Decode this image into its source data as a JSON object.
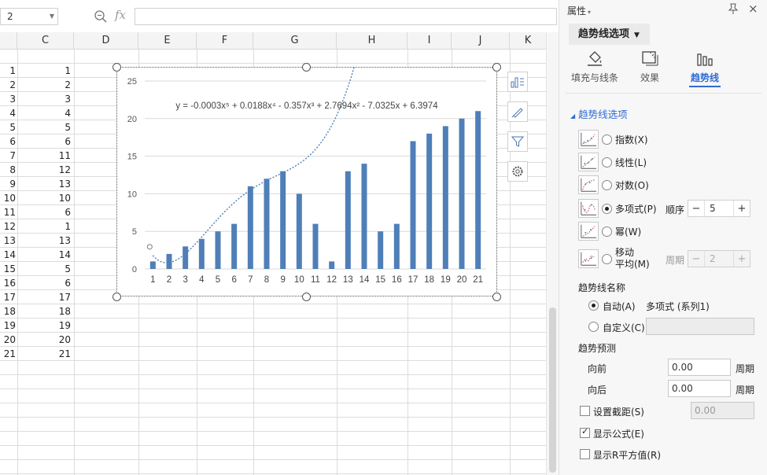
{
  "formula_bar": {
    "name_box": "2",
    "fx_label": "fx",
    "formula": ""
  },
  "columns": [
    "C",
    "D",
    "E",
    "F",
    "G",
    "H",
    "I",
    "J",
    "K"
  ],
  "rows": [
    {
      "n": "1",
      "c": "1"
    },
    {
      "n": "2",
      "c": "2"
    },
    {
      "n": "3",
      "c": "3"
    },
    {
      "n": "4",
      "c": "4"
    },
    {
      "n": "5",
      "c": "5"
    },
    {
      "n": "6",
      "c": "6"
    },
    {
      "n": "7",
      "c": "11"
    },
    {
      "n": "8",
      "c": "12"
    },
    {
      "n": "9",
      "c": "13"
    },
    {
      "n": "10",
      "c": "10"
    },
    {
      "n": "11",
      "c": "6"
    },
    {
      "n": "12",
      "c": "1"
    },
    {
      "n": "13",
      "c": "13"
    },
    {
      "n": "14",
      "c": "14"
    },
    {
      "n": "15",
      "c": "5"
    },
    {
      "n": "16",
      "c": "6"
    },
    {
      "n": "17",
      "c": "17"
    },
    {
      "n": "18",
      "c": "18"
    },
    {
      "n": "19",
      "c": "19"
    },
    {
      "n": "20",
      "c": "20"
    },
    {
      "n": "21",
      "c": "21"
    }
  ],
  "chart_data": {
    "type": "bar",
    "categories": [
      "1",
      "2",
      "3",
      "4",
      "5",
      "6",
      "7",
      "8",
      "9",
      "10",
      "11",
      "12",
      "13",
      "14",
      "15",
      "16",
      "17",
      "18",
      "19",
      "20",
      "21"
    ],
    "values": [
      1,
      2,
      3,
      4,
      5,
      6,
      11,
      12,
      13,
      10,
      6,
      1,
      13,
      14,
      5,
      6,
      17,
      18,
      19,
      20,
      21
    ],
    "ylim": [
      0,
      25
    ],
    "yticks": [
      "0",
      "5",
      "10",
      "15",
      "20",
      "25"
    ],
    "grid": true,
    "bar_color": "#4f7fb8",
    "trendline": {
      "type": "polynomial",
      "order": 5,
      "color": "#4f7fb8",
      "equation": "y = -0.0003x⁵ + 0.0188x⁴ - 0.357x³ + 2.7694x² - 7.0325x + 6.3974",
      "coefficients": [
        6.3974,
        -7.0325,
        2.7694,
        -0.357,
        0.0188,
        -0.0003
      ]
    }
  },
  "chart_tools": [
    "chart-elements-icon",
    "chart-style-icon",
    "chart-filter-icon",
    "chart-settings-icon"
  ],
  "pane": {
    "title": "属性",
    "dropdown": "趋势线选项",
    "tabs": [
      {
        "label": "填充与线条",
        "icon": "fill-bucket-icon"
      },
      {
        "label": "效果",
        "icon": "effects-icon"
      },
      {
        "label": "趋势线",
        "icon": "trendline-bars-icon",
        "active": true
      }
    ],
    "section": "趋势线选项",
    "types": [
      {
        "label": "指数(X)",
        "selected": false
      },
      {
        "label": "线性(L)",
        "selected": false
      },
      {
        "label": "对数(O)",
        "selected": false
      },
      {
        "label": "多项式(P)",
        "selected": true
      },
      {
        "label": "幂(W)",
        "selected": false
      },
      {
        "label": "移动",
        "label2": "平均(M)",
        "selected": false
      }
    ],
    "order_label": "顺序",
    "order_value": "5",
    "period_label": "周期",
    "period_value": "2",
    "name_heading": "趋势线名称",
    "auto_label": "自动(A)",
    "auto_value": "多项式 (系列1)",
    "custom_label": "自定义(C)",
    "forecast_heading": "趋势预测",
    "forward_label": "向前",
    "forward_value": "0.00",
    "backward_label": "向后",
    "backward_value": "0.00",
    "unit": "周期",
    "intercept_label": "设置截距(S)",
    "intercept_value": "0.00",
    "show_formula_label": "显示公式(E)",
    "show_r2_label": "显示R平方值(R)"
  }
}
